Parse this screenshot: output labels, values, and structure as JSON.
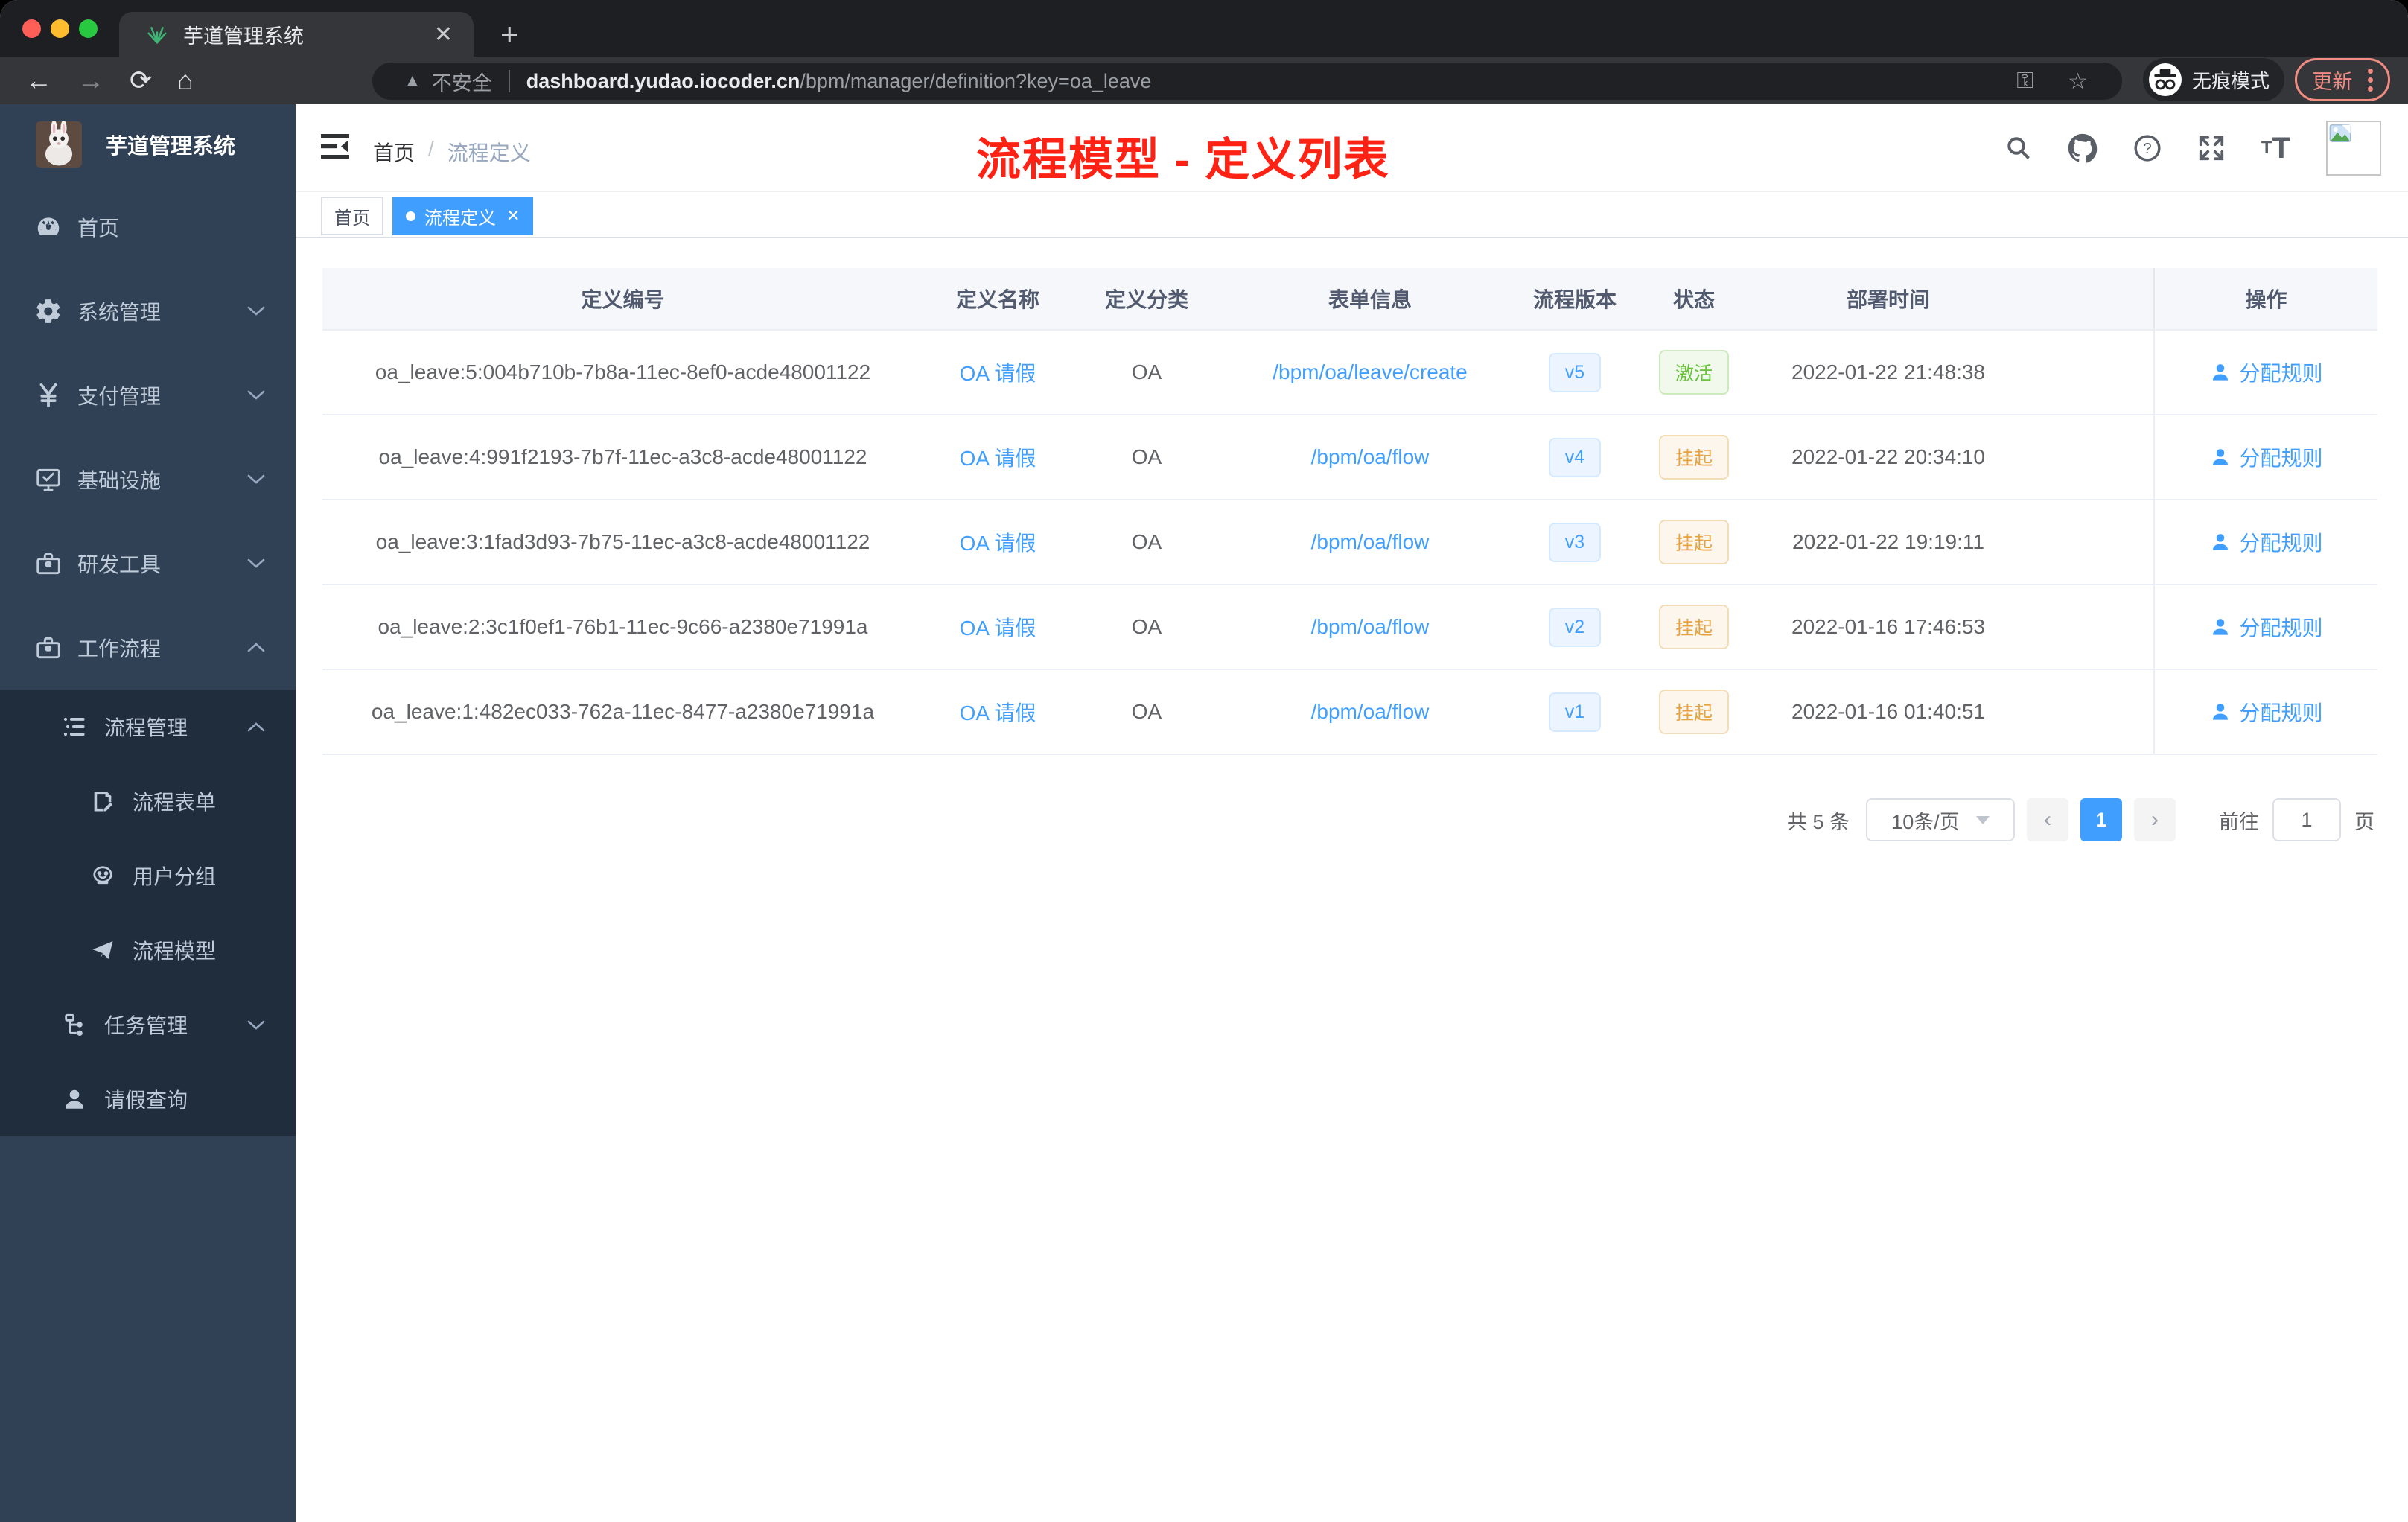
{
  "browser": {
    "tab_title": "芋道管理系统",
    "new_tab_glyph": "+",
    "close_tab_glyph": "✕",
    "security_label": "不安全",
    "url_domain": "dashboard.yudao.iocoder.cn",
    "url_path": "/bpm/manager/definition?key=oa_leave",
    "incognito_label": "无痕模式",
    "update_label": "更新",
    "traffic_colors": {
      "close": "#ff5f57",
      "minimize": "#febc2e",
      "zoom": "#28c840"
    }
  },
  "sidebar": {
    "app_title": "芋道管理系统",
    "items": [
      {
        "label": "首页",
        "icon": "dashboard-icon",
        "chevron": "none"
      },
      {
        "label": "系统管理",
        "icon": "gear-icon",
        "chevron": "down"
      },
      {
        "label": "支付管理",
        "icon": "yen-icon",
        "chevron": "down"
      },
      {
        "label": "基础设施",
        "icon": "monitor-icon",
        "chevron": "down"
      },
      {
        "label": "研发工具",
        "icon": "toolbox-icon",
        "chevron": "down"
      },
      {
        "label": "工作流程",
        "icon": "briefcase-icon",
        "chevron": "up"
      }
    ],
    "submenu": [
      {
        "label": "流程管理",
        "icon": "list-tree-icon",
        "level": 1,
        "chevron": "up"
      },
      {
        "label": "流程表单",
        "icon": "form-edit-icon",
        "level": 2,
        "chevron": "none"
      },
      {
        "label": "用户分组",
        "icon": "user-group-icon",
        "level": 2,
        "chevron": "none"
      },
      {
        "label": "流程模型",
        "icon": "paper-plane-icon",
        "level": 2,
        "chevron": "none"
      },
      {
        "label": "任务管理",
        "icon": "task-flow-icon",
        "level": 1,
        "chevron": "down"
      },
      {
        "label": "请假查询",
        "icon": "person-icon",
        "level": 1,
        "chevron": "none"
      }
    ]
  },
  "header": {
    "breadcrumb": {
      "first": "首页",
      "separator": "/",
      "last": "流程定义"
    },
    "annotation": "流程模型 - 定义列表"
  },
  "tags": [
    {
      "label": "首页",
      "active": false,
      "closable": false
    },
    {
      "label": "流程定义",
      "active": true,
      "closable": true
    }
  ],
  "table": {
    "columns": [
      "定义编号",
      "定义名称",
      "定义分类",
      "表单信息",
      "流程版本",
      "状态",
      "部署时间",
      "操作"
    ],
    "rows": [
      {
        "id": "oa_leave:5:004b710b-7b8a-11ec-8ef0-acde48001122",
        "name": "OA 请假",
        "category": "OA",
        "form": "/bpm/oa/leave/create",
        "version": "v5",
        "status": "激活",
        "status_type": "success",
        "deployed_at": "2022-01-22 21:48:38",
        "action": "分配规则"
      },
      {
        "id": "oa_leave:4:991f2193-7b7f-11ec-a3c8-acde48001122",
        "name": "OA 请假",
        "category": "OA",
        "form": "/bpm/oa/flow",
        "version": "v4",
        "status": "挂起",
        "status_type": "warning",
        "deployed_at": "2022-01-22 20:34:10",
        "action": "分配规则"
      },
      {
        "id": "oa_leave:3:1fad3d93-7b75-11ec-a3c8-acde48001122",
        "name": "OA 请假",
        "category": "OA",
        "form": "/bpm/oa/flow",
        "version": "v3",
        "status": "挂起",
        "status_type": "warning",
        "deployed_at": "2022-01-22 19:19:11",
        "action": "分配规则"
      },
      {
        "id": "oa_leave:2:3c1f0ef1-76b1-11ec-9c66-a2380e71991a",
        "name": "OA 请假",
        "category": "OA",
        "form": "/bpm/oa/flow",
        "version": "v2",
        "status": "挂起",
        "status_type": "warning",
        "deployed_at": "2022-01-16 17:46:53",
        "action": "分配规则"
      },
      {
        "id": "oa_leave:1:482ec033-762a-11ec-8477-a2380e71991a",
        "name": "OA 请假",
        "category": "OA",
        "form": "/bpm/oa/flow",
        "version": "v1",
        "status": "挂起",
        "status_type": "warning",
        "deployed_at": "2022-01-16 01:40:51",
        "action": "分配规则"
      }
    ]
  },
  "pagination": {
    "total_label": "共 5 条",
    "page_size_label": "10条/页",
    "prev_glyph": "‹",
    "next_glyph": "›",
    "current_page": "1",
    "goto_label": "前往",
    "goto_value": "1",
    "page_unit": "页"
  },
  "colors": {
    "accent_blue": "#409eff",
    "sidebar_bg": "#304156",
    "submenu_bg": "#1f2d3d",
    "annotation_red": "#fe2214",
    "success_green": "#67c23a",
    "warning_orange": "#e6a23c"
  }
}
